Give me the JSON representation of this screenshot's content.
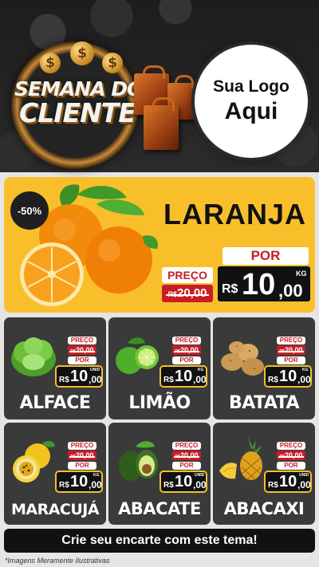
{
  "header": {
    "title_line1": "SEMANA DO",
    "title_line2": "CLIENTE",
    "dollar_symbol": "$",
    "logo_line1": "Sua Logo",
    "logo_line2": "Aqui"
  },
  "hero": {
    "discount": "-50%",
    "name": "LARANJA",
    "price_label": "PREÇO",
    "old_currency": "R$",
    "old_price": "20,00",
    "por_label": "POR",
    "currency": "R$",
    "new_int": "10",
    "new_dec": ",00",
    "unit": "KG"
  },
  "products": [
    {
      "name": "ALFACE",
      "price_label": "PREÇO",
      "old_currency": "R$",
      "old_price": "20,00",
      "por_label": "POR",
      "currency": "R$",
      "new_int": "10",
      "new_dec": ",00",
      "unit": "UNID",
      "icon": "lettuce-icon"
    },
    {
      "name": "LIMÃO",
      "price_label": "PREÇO",
      "old_currency": "R$",
      "old_price": "20,00",
      "por_label": "POR",
      "currency": "R$",
      "new_int": "10",
      "new_dec": ",00",
      "unit": "KG",
      "icon": "lime-icon"
    },
    {
      "name": "BATATA",
      "price_label": "PREÇO",
      "old_currency": "R$",
      "old_price": "20,00",
      "por_label": "POR",
      "currency": "R$",
      "new_int": "10",
      "new_dec": ",00",
      "unit": "KG",
      "icon": "potato-icon"
    },
    {
      "name": "MARACUJÁ",
      "price_label": "PREÇO",
      "old_currency": "R$",
      "old_price": "20,00",
      "por_label": "POR",
      "currency": "R$",
      "new_int": "10",
      "new_dec": ",00",
      "unit": "KG",
      "icon": "passion-fruit-icon"
    },
    {
      "name": "ABACATE",
      "price_label": "PREÇO",
      "old_currency": "R$",
      "old_price": "20,00",
      "por_label": "POR",
      "currency": "R$",
      "new_int": "10",
      "new_dec": ",00",
      "unit": "UNID",
      "icon": "avocado-icon"
    },
    {
      "name": "ABACAXI",
      "price_label": "PREÇO",
      "old_currency": "R$",
      "old_price": "20,00",
      "por_label": "POR",
      "currency": "R$",
      "new_int": "10",
      "new_dec": ",00",
      "unit": "UNID",
      "icon": "pineapple-icon"
    }
  ],
  "cta": {
    "label": "Crie seu encarte com este tema!"
  },
  "footnote": "*Imagens Meramente Ilustrativas",
  "colors": {
    "hero_bg": "#f9bf2b",
    "card_bg": "#3a3a3a",
    "price_red": "#c81d25",
    "price_border": "#f0c030"
  }
}
